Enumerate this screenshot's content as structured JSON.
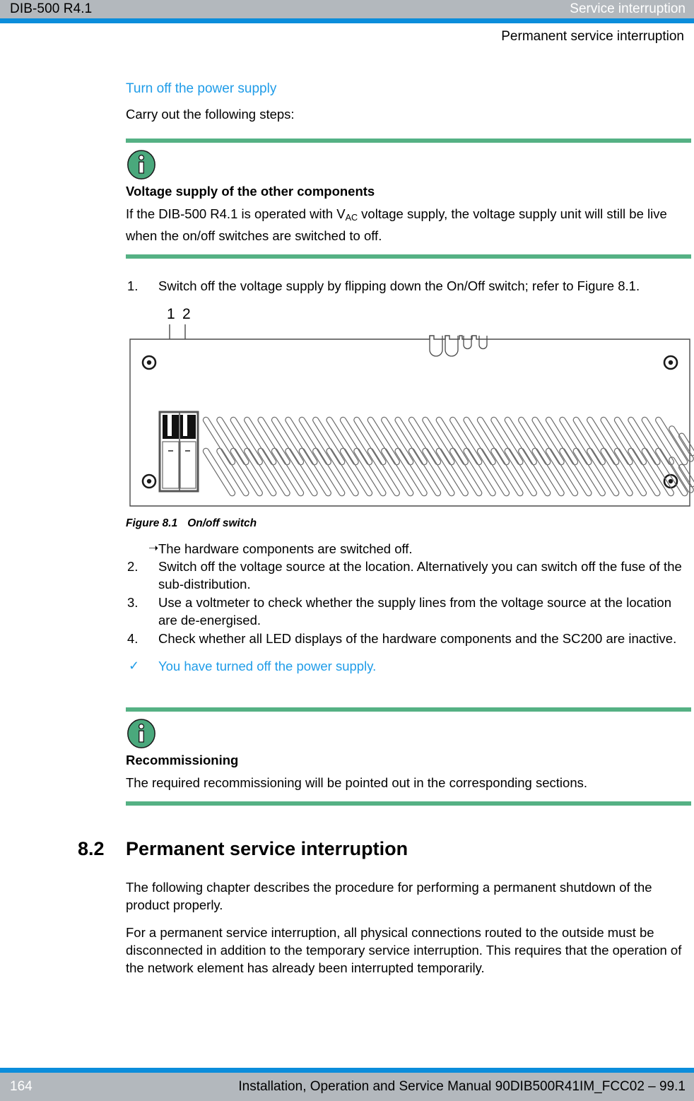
{
  "header": {
    "product": "DIB-500 R4.1",
    "chapter": "Service interruption",
    "section": "Permanent service interruption"
  },
  "content": {
    "sub_heading": "Turn off the power supply",
    "intro": "Carry out the following steps:"
  },
  "note_voltage": {
    "icon": "info-icon",
    "title": "Voltage supply of the other components",
    "text_before": "If the DIB-500 R4.1 is operated with V",
    "text_sub": "AC",
    "text_after": " voltage supply, the voltage supply unit will still be live when the on/off switches are switched to off."
  },
  "steps": [
    {
      "num": "1.",
      "text": "Switch off the voltage supply by flipping down the On/Off switch; refer to Figure 8.1."
    },
    {
      "num": "2.",
      "text": "Switch off the voltage source at the location. Alternatively you can switch off the fuse of the sub-distribution."
    },
    {
      "num": "3.",
      "text": "Use a voltmeter to check whether the supply lines from the voltage source at the location are de-energised."
    },
    {
      "num": "4.",
      "text": "Check whether all LED displays of the hardware components and the SC200 are inactive."
    }
  ],
  "result": {
    "arrow": "➝",
    "text": "The hardware components are switched off."
  },
  "confirmation": {
    "tick": "✓",
    "text": "You have turned off the power supply."
  },
  "figure": {
    "caption_id": "Figure 8.1",
    "caption_text": "On/off switch",
    "callouts": [
      {
        "label": "1"
      },
      {
        "label": "2"
      }
    ]
  },
  "note_recommissioning": {
    "icon": "info-icon",
    "title": "Recommissioning",
    "text": "The required recommissioning will be pointed out in the corresponding sections."
  },
  "section": {
    "number": "8.2",
    "title": "Permanent service interruption",
    "paragraphs": [
      "The following chapter describes the procedure for performing a permanent shutdown of the product properly.",
      "For a permanent service interruption, all physical connections routed to the outside must be disconnected in addition to the temporary service interruption. This requires that the operation of the network element has already been interrupted temporarily."
    ]
  },
  "footer": {
    "page_number": "164",
    "manual_text": "Installation, Operation and Service Manual 90DIB500R41IM_FCC02  –  99.1"
  },
  "colors": {
    "accent_blue": "#0b8ddb",
    "link_blue": "#1f9ce8",
    "band_gray": "#b3b8bd",
    "note_green": "#55b184"
  }
}
